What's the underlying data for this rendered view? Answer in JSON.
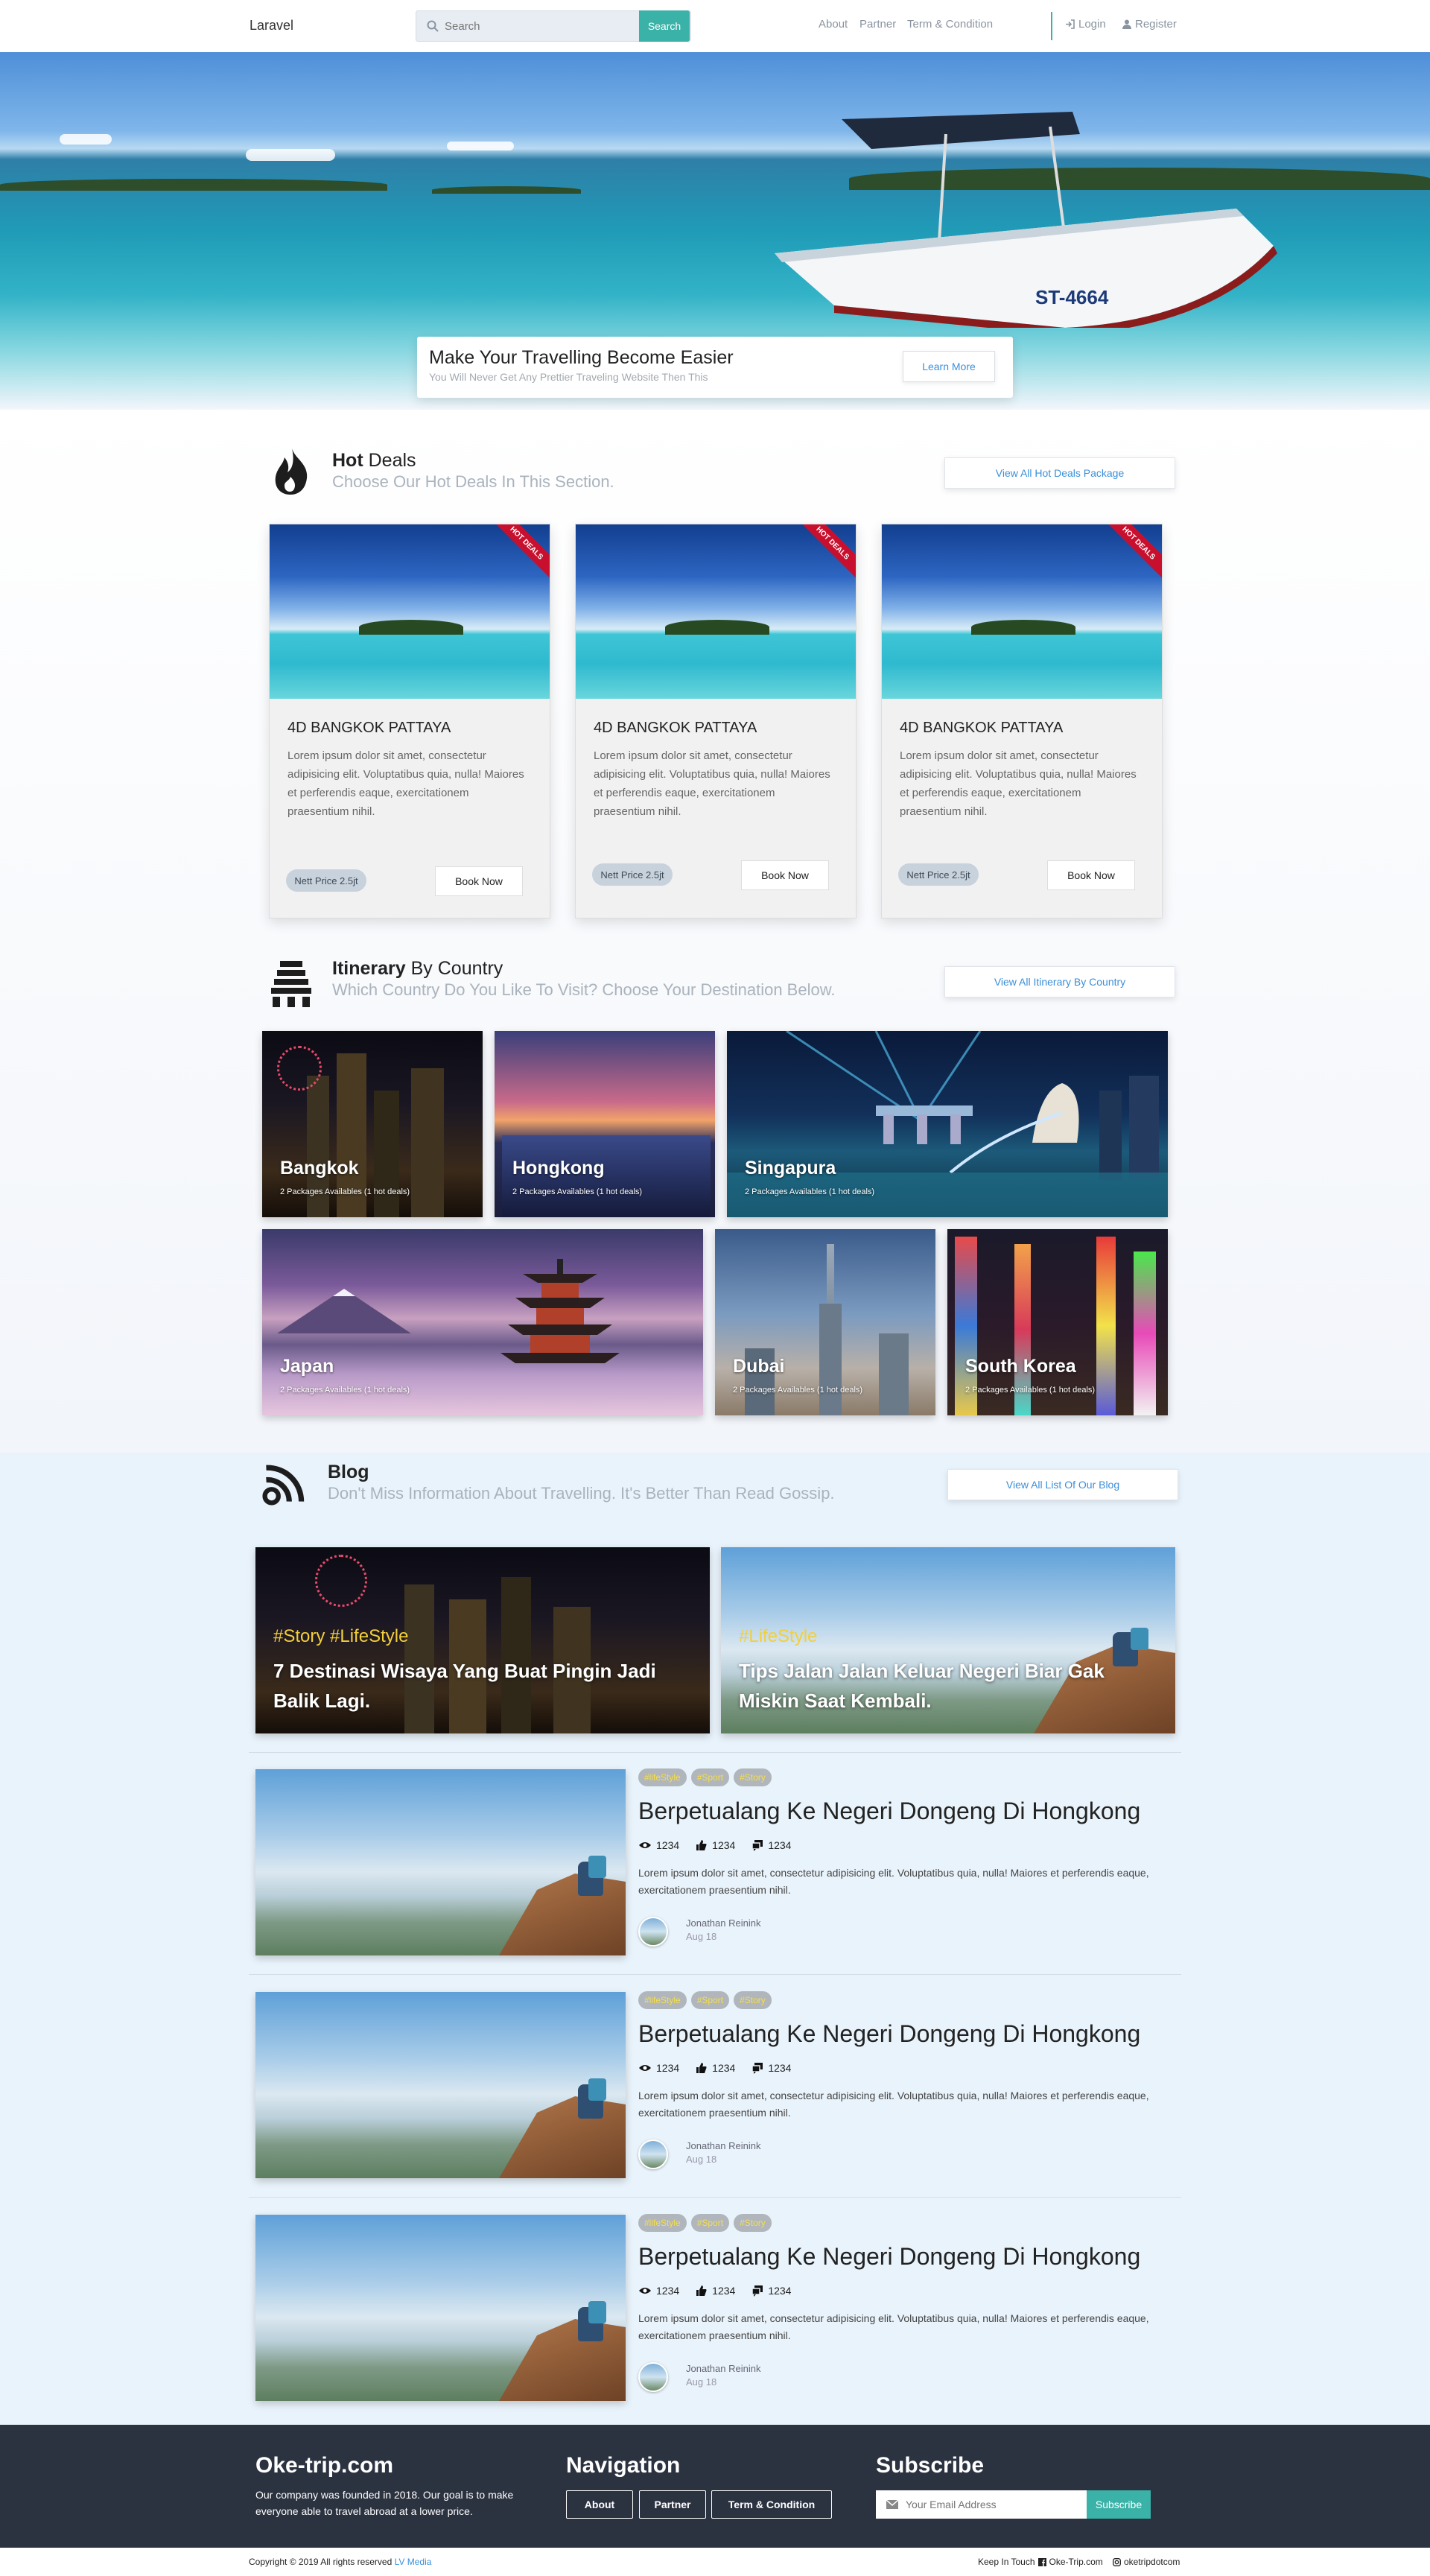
{
  "navbar": {
    "brand": "Laravel",
    "search_placeholder": "Search",
    "search_button": "Search",
    "links": [
      "About",
      "Partner",
      "Term & Condition"
    ],
    "login": "Login",
    "register": "Register"
  },
  "hero": {
    "boat_label": "ST-4664",
    "title": "Make Your Travelling Become Easier",
    "subtitle": "You Will Never Get Any Prettier Traveling Website Then This",
    "button": "Learn More"
  },
  "hot_deals": {
    "title_bold": "Hot",
    "title_rest": "Deals",
    "subtitle": "Choose Our Hot Deals In This Section.",
    "view_all": "View All Hot Deals Package",
    "cards": [
      {
        "ribbon": "HOT DEALS",
        "title": "4D BANGKOK PATTAYA",
        "text": "Lorem ipsum dolor sit amet, consectetur adipisicing elit. Voluptatibus quia, nulla! Maiores et perferendis eaque, exercitationem praesentium nihil.",
        "price": "Nett Price 2.5jt",
        "button": "Book Now"
      },
      {
        "ribbon": "HOT DEALS",
        "title": "4D BANGKOK PATTAYA",
        "text": "Lorem ipsum dolor sit amet, consectetur adipisicing elit. Voluptatibus quia, nulla! Maiores et perferendis eaque, exercitationem praesentium nihil.",
        "price": "Nett Price 2.5jt",
        "button": "Book Now"
      },
      {
        "ribbon": "HOT DEALS",
        "title": "4D BANGKOK PATTAYA",
        "text": "Lorem ipsum dolor sit amet, consectetur adipisicing elit. Voluptatibus quia, nulla! Maiores et perferendis eaque, exercitationem praesentium nihil.",
        "price": "Nett Price 2.5jt",
        "button": "Book Now"
      }
    ]
  },
  "itinerary": {
    "title_bold": "Itinerary",
    "title_rest": "By Country",
    "subtitle": "Which Country Do You Like To Visit? Choose Your Destination Below.",
    "view_all": "View All Itinerary By Country",
    "countries": [
      {
        "name": "Bangkok",
        "info": "2 Packages Availables (1 hot deals)"
      },
      {
        "name": "Hongkong",
        "info": "2 Packages Availables (1 hot deals)"
      },
      {
        "name": "Singapura",
        "info": "2 Packages Availables (1 hot deals)"
      },
      {
        "name": "Japan",
        "info": "2 Packages Availables (1 hot deals)"
      },
      {
        "name": "Dubai",
        "info": "2 Packages Availables (1 hot deals)"
      },
      {
        "name": "South Korea",
        "info": "2 Packages Availables (1 hot deals)"
      }
    ]
  },
  "blog": {
    "title": "Blog",
    "subtitle": "Don't Miss Information About Travelling. It's Better Than Read Gossip.",
    "view_all": "View All List Of Our Blog",
    "featured": [
      {
        "tags": "#Story #LifeStyle",
        "title": "7 Destinasi Wisaya Yang Buat Pingin Jadi Balik Lagi."
      },
      {
        "tags": "#LifeStyle",
        "title": "Tips Jalan Jalan Keluar Negeri Biar Gak Miskin Saat Kembali."
      }
    ],
    "posts": [
      {
        "tags": [
          "#lifeStyle",
          "#Sport",
          "#Story"
        ],
        "title": "Berpetualang Ke Negeri Dongeng Di Hongkong",
        "views": "1234",
        "likes": "1234",
        "comments": "1234",
        "text": "Lorem ipsum dolor sit amet, consectetur adipisicing elit. Voluptatibus quia, nulla! Maiores et perferendis eaque, exercitationem praesentium nihil.",
        "author": "Jonathan Reinink",
        "date": "Aug 18"
      },
      {
        "tags": [
          "#lifeStyle",
          "#Sport",
          "#Story"
        ],
        "title": "Berpetualang Ke Negeri Dongeng Di Hongkong",
        "views": "1234",
        "likes": "1234",
        "comments": "1234",
        "text": "Lorem ipsum dolor sit amet, consectetur adipisicing elit. Voluptatibus quia, nulla! Maiores et perferendis eaque, exercitationem praesentium nihil.",
        "author": "Jonathan Reinink",
        "date": "Aug 18"
      },
      {
        "tags": [
          "#lifeStyle",
          "#Sport",
          "#Story"
        ],
        "title": "Berpetualang Ke Negeri Dongeng Di Hongkong",
        "views": "1234",
        "likes": "1234",
        "comments": "1234",
        "text": "Lorem ipsum dolor sit amet, consectetur adipisicing elit. Voluptatibus quia, nulla! Maiores et perferendis eaque, exercitationem praesentium nihil.",
        "author": "Jonathan Reinink",
        "date": "Aug 18"
      }
    ]
  },
  "footer": {
    "about_title": "Oke-trip.com",
    "about_text": "Our company was founded in 2018. Our goal is to make everyone able to travel abroad at a lower price.",
    "nav_title": "Navigation",
    "nav_buttons": [
      "About",
      "Partner",
      "Term & Condition"
    ],
    "subscribe_title": "Subscribe",
    "email_placeholder": "Your Email Address",
    "subscribe_button": "Subscribe",
    "copyright": "Copyright © 2019 All rights reserved",
    "copyright_link": "LV Media",
    "keep_in_touch": "Keep In Touch",
    "facebook": "Oke-Trip.com",
    "instagram": "oketripdotcom"
  },
  "colors": {
    "accent": "#3bb2a7",
    "link": "#3b8fd9",
    "ribbon": "#c8102e",
    "footer_bg": "#2b3240",
    "tag_text": "#f7de47"
  }
}
